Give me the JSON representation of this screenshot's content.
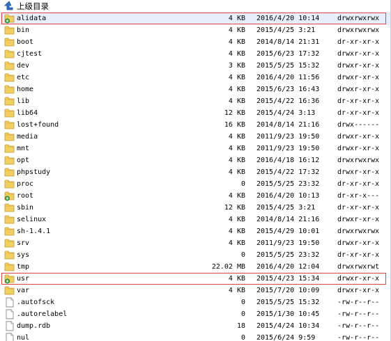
{
  "nav": {
    "up_label": "上级目录"
  },
  "files": [
    {
      "name": "alidata",
      "size": "4 KB",
      "date": "2016/4/20 10:14",
      "perm": "drwxrwxrwx",
      "type": "folder",
      "badge": true,
      "selected": true
    },
    {
      "name": "bin",
      "size": "4 KB",
      "date": "2015/4/25 3:21",
      "perm": "drwxrwxrwx",
      "type": "folder"
    },
    {
      "name": "boot",
      "size": "4 KB",
      "date": "2014/8/14 21:31",
      "perm": "dr-xr-xr-x",
      "type": "folder"
    },
    {
      "name": "cjtest",
      "size": "4 KB",
      "date": "2015/6/23 17:32",
      "perm": "drwxr-xr-x",
      "type": "folder"
    },
    {
      "name": "dev",
      "size": "3 KB",
      "date": "2015/5/25 15:32",
      "perm": "drwxr-xr-x",
      "type": "folder"
    },
    {
      "name": "etc",
      "size": "4 KB",
      "date": "2016/4/20 11:56",
      "perm": "drwxr-xr-x",
      "type": "folder"
    },
    {
      "name": "home",
      "size": "4 KB",
      "date": "2015/6/23 16:43",
      "perm": "drwxr-xr-x",
      "type": "folder"
    },
    {
      "name": "lib",
      "size": "4 KB",
      "date": "2015/4/22 16:36",
      "perm": "dr-xr-xr-x",
      "type": "folder"
    },
    {
      "name": "lib64",
      "size": "12 KB",
      "date": "2015/4/24 3:13",
      "perm": "dr-xr-xr-x",
      "type": "folder"
    },
    {
      "name": "lost+found",
      "size": "16 KB",
      "date": "2014/8/14 21:16",
      "perm": "drwx------",
      "type": "folder"
    },
    {
      "name": "media",
      "size": "4 KB",
      "date": "2011/9/23 19:50",
      "perm": "drwxr-xr-x",
      "type": "folder"
    },
    {
      "name": "mnt",
      "size": "4 KB",
      "date": "2011/9/23 19:50",
      "perm": "drwxr-xr-x",
      "type": "folder"
    },
    {
      "name": "opt",
      "size": "4 KB",
      "date": "2016/4/18 16:12",
      "perm": "drwxrwxrwx",
      "type": "folder"
    },
    {
      "name": "phpstudy",
      "size": "4 KB",
      "date": "2015/4/22 17:32",
      "perm": "drwxr-xr-x",
      "type": "folder"
    },
    {
      "name": "proc",
      "size": "0",
      "date": "2015/5/25 23:32",
      "perm": "dr-xr-xr-x",
      "type": "folder"
    },
    {
      "name": "root",
      "size": "4 KB",
      "date": "2016/4/20 10:13",
      "perm": "dr-xr-x---",
      "type": "folder",
      "badge": true
    },
    {
      "name": "sbin",
      "size": "12 KB",
      "date": "2015/4/25 3:21",
      "perm": "dr-xr-xr-x",
      "type": "folder"
    },
    {
      "name": "selinux",
      "size": "4 KB",
      "date": "2014/8/14 21:16",
      "perm": "drwxr-xr-x",
      "type": "folder"
    },
    {
      "name": "sh-1.4.1",
      "size": "4 KB",
      "date": "2015/4/29 10:01",
      "perm": "drwxrwxrwx",
      "type": "folder"
    },
    {
      "name": "srv",
      "size": "4 KB",
      "date": "2011/9/23 19:50",
      "perm": "drwxr-xr-x",
      "type": "folder"
    },
    {
      "name": "sys",
      "size": "0",
      "date": "2015/5/25 23:32",
      "perm": "dr-xr-xr-x",
      "type": "folder"
    },
    {
      "name": "tmp",
      "size": "22.02 MB",
      "date": "2016/4/20 12:04",
      "perm": "drwxrwxrwt",
      "type": "folder"
    },
    {
      "name": "usr",
      "size": "4 KB",
      "date": "2015/4/23 15:34",
      "perm": "drwxr-xr-x",
      "type": "folder",
      "badge": true,
      "boxed": true
    },
    {
      "name": "var",
      "size": "4 KB",
      "date": "2015/7/20 10:09",
      "perm": "drwxr-xr-x",
      "type": "folder"
    },
    {
      "name": ".autofsck",
      "size": "0",
      "date": "2015/5/25 15:32",
      "perm": "-rw-r--r--",
      "type": "file"
    },
    {
      "name": ".autorelabel",
      "size": "0",
      "date": "2015/1/30 10:45",
      "perm": "-rw-r--r--",
      "type": "file"
    },
    {
      "name": "dump.rdb",
      "size": "18",
      "date": "2015/4/24 10:34",
      "perm": "-rw-r--r--",
      "type": "file"
    },
    {
      "name": "nul",
      "size": "0",
      "date": "2015/6/24 9:59",
      "perm": "-rw-r--r--",
      "type": "file"
    }
  ]
}
